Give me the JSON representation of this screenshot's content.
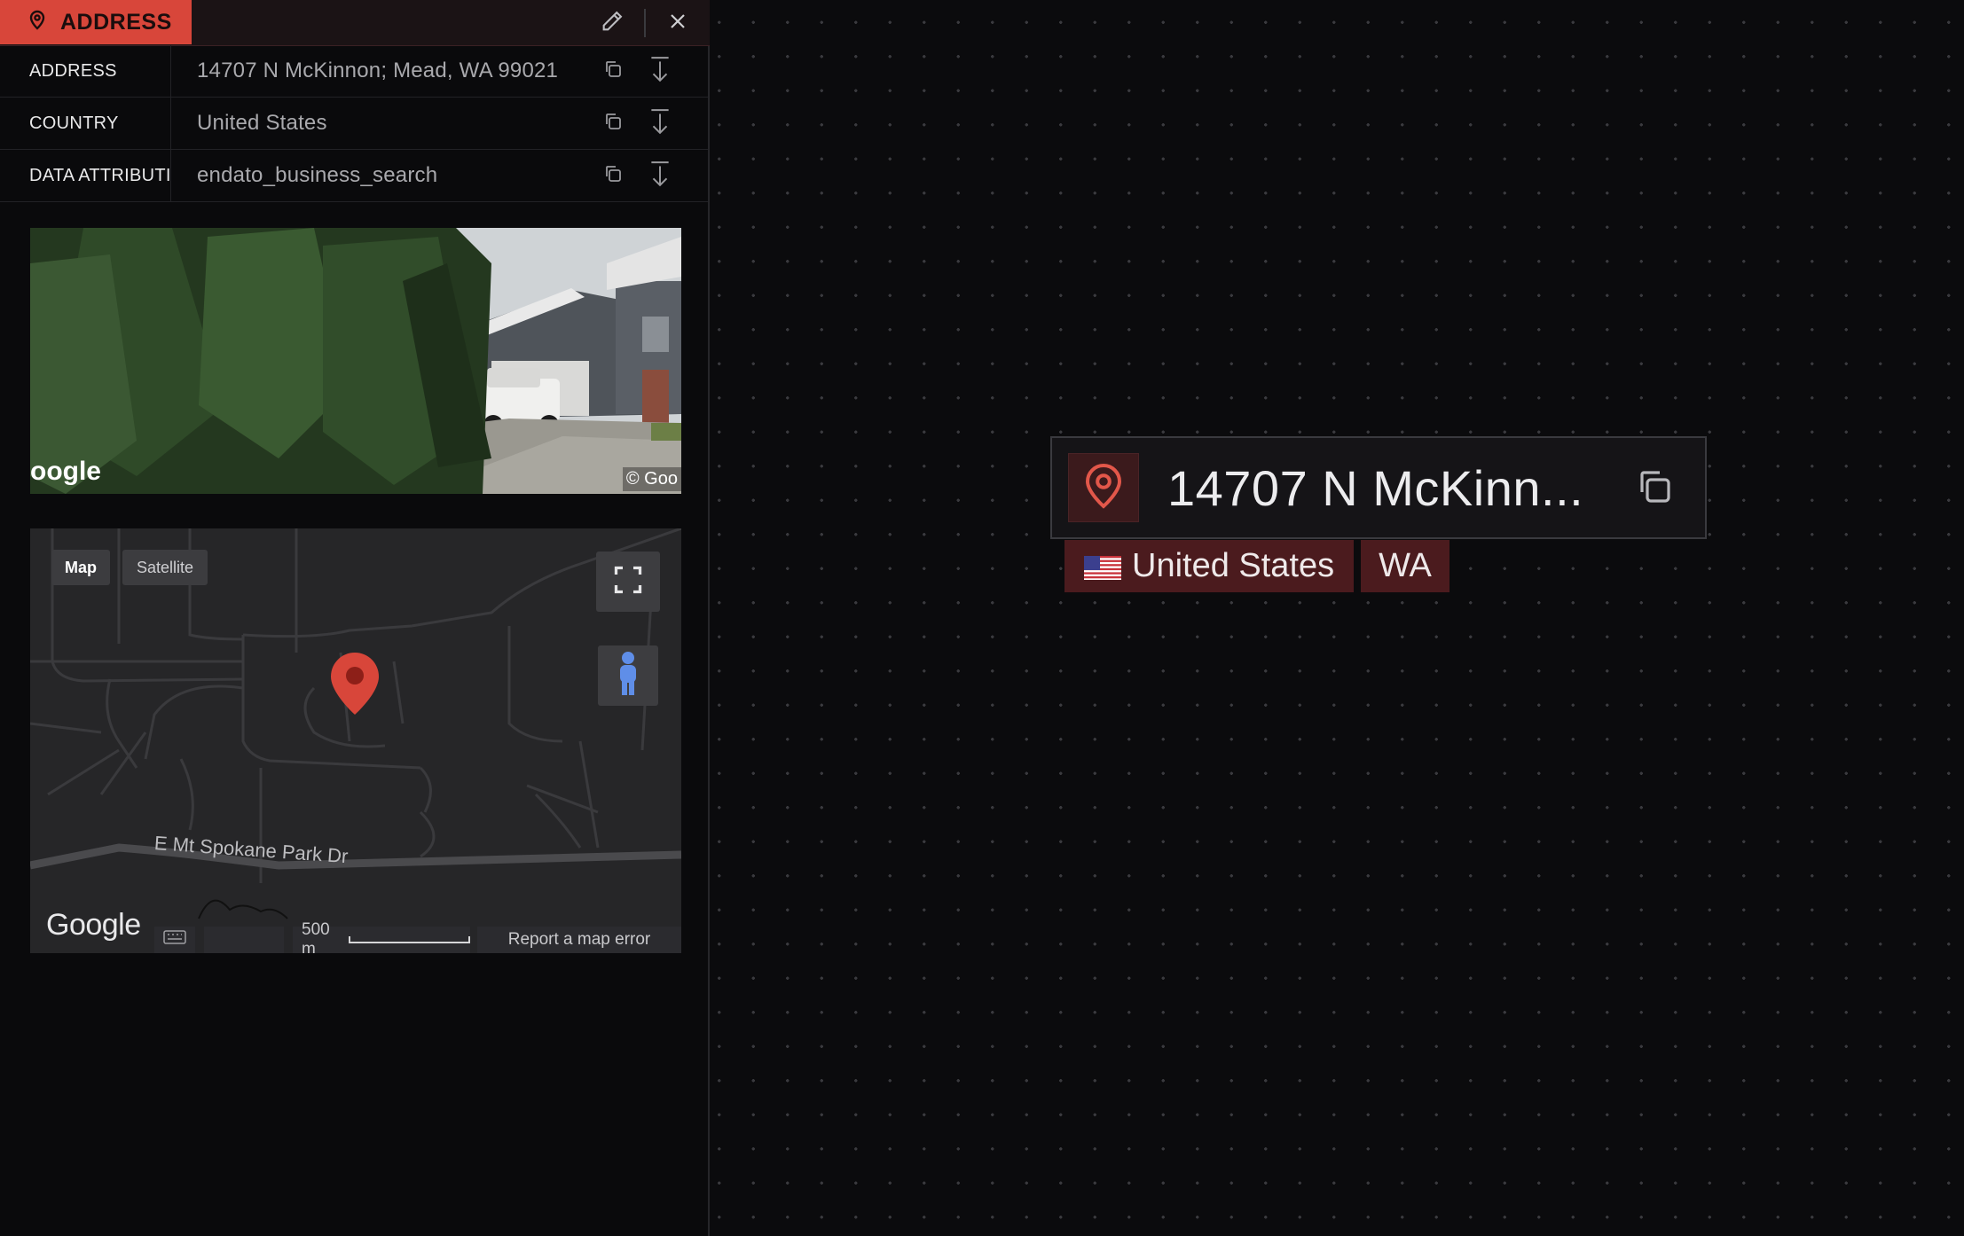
{
  "panel": {
    "type_label": "ADDRESS",
    "accent_color": "#d8463a",
    "header_icons": [
      "location-pin-icon",
      "pencil-icon",
      "close-icon"
    ],
    "properties": [
      {
        "key": "ADDRESS",
        "value": "14707 N McKinnon; Mead, WA 99021"
      },
      {
        "key": "COUNTRY",
        "value": "United States"
      },
      {
        "key": "DATA ATTRIBUTI",
        "value": "endato_business_search"
      }
    ],
    "row_icons": [
      "copy-icon",
      "download-icon"
    ]
  },
  "street_view": {
    "watermark_left": "oogle",
    "watermark_right": "© Goo"
  },
  "map": {
    "map_button": "Map",
    "satellite_button": "Satellite",
    "road_label": "E Mt Spokane Park Dr",
    "logo": "Google",
    "scale": "500 m",
    "report_link": "Report a map error",
    "marker_color": "#d8463a"
  },
  "node": {
    "title": "14707 N McKinn...",
    "tags": [
      {
        "label": "United States",
        "icon": "us-flag-icon"
      },
      {
        "label": "WA"
      }
    ],
    "tag_color": "#4b1b1e"
  }
}
